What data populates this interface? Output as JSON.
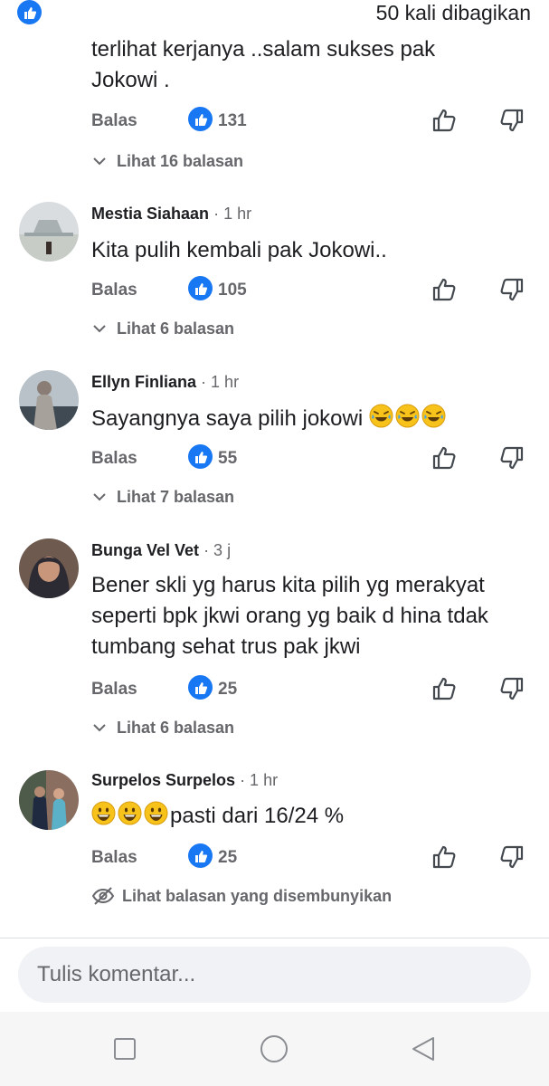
{
  "header": {
    "share_count_text": "50 kali dibagikan",
    "like_icon": "thumbs-up-icon"
  },
  "accent_color": "#1877f2",
  "secondary_text_color": "#65676b",
  "comments": [
    {
      "body": "terlihat kerjanya ..salam sukses pak Jokowi .",
      "reply_label": "Balas",
      "like_count": "131",
      "replies_label": "Lihat 16 balasan"
    },
    {
      "author": "Mestia Siahaan",
      "time": "· 1 hr",
      "body": "Kita pulih kembali pak Jokowi..",
      "reply_label": "Balas",
      "like_count": "105",
      "replies_label": "Lihat 6 balasan"
    },
    {
      "author": "Ellyn Finliana",
      "time": "· 1 hr",
      "body": "Sayangnya saya pilih jokowi",
      "emojis": [
        "rolling-laugh-emoji",
        "rolling-laugh-emoji",
        "rolling-laugh-emoji"
      ],
      "reply_label": "Balas",
      "like_count": "55",
      "replies_label": "Lihat 7 balasan"
    },
    {
      "author": "Bunga Vel Vet",
      "time": "· 3 j",
      "body": "Bener skli yg harus kita pilih yg merakyat seperti bpk jkwi orang yg baik d hina tdak tumbang sehat trus pak jkwi",
      "reply_label": "Balas",
      "like_count": "25",
      "replies_label": "Lihat 6 balasan"
    },
    {
      "author": "Surpelos Surpelos",
      "time": "· 1 hr",
      "emojis": [
        "grinning-emoji",
        "grinning-emoji",
        "grinning-emoji"
      ],
      "body": "pasti dari  16/24 %",
      "reply_label": "Balas",
      "like_count": "25",
      "replies_label": "Lihat balasan yang disembunyikan"
    }
  ],
  "composer": {
    "placeholder": "Tulis komentar..."
  },
  "navigation": {
    "icons": [
      "recent-apps-icon",
      "home-icon",
      "back-icon"
    ]
  }
}
